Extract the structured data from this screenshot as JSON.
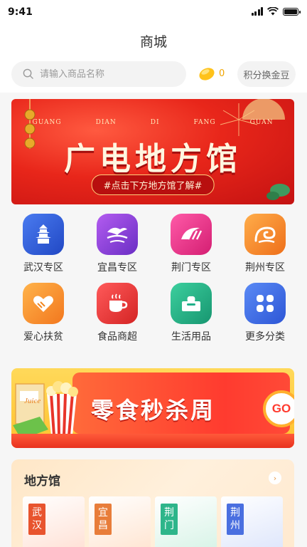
{
  "status_bar": {
    "time": "9:41"
  },
  "header": {
    "title": "商城"
  },
  "search": {
    "placeholder": "请输入商品名称",
    "coin_count": "0",
    "exchange_label": "积分换金豆"
  },
  "banner": {
    "pinyin": [
      "GUANG",
      "DIAN",
      "DI",
      "FANG",
      "GUAN"
    ],
    "title": "广电地方馆",
    "subtitle": "#点击下方地方馆了解#"
  },
  "categories": [
    {
      "label": "武汉专区",
      "icon": "wuhan-tower-icon",
      "color": "#2f5fd9"
    },
    {
      "label": "宜昌专区",
      "icon": "yichang-river-icon",
      "color": "#8a3fd9"
    },
    {
      "label": "荆门专区",
      "icon": "jingmen-emblem-icon",
      "color": "#e8348f"
    },
    {
      "label": "荆州专区",
      "icon": "jingzhou-wave-icon",
      "color": "#f28a2a"
    },
    {
      "label": "爱心扶贫",
      "icon": "heart-hands-icon",
      "color": "#f59a30"
    },
    {
      "label": "食品商超",
      "icon": "coffee-cup-icon",
      "color": "#e63b3b"
    },
    {
      "label": "生活用品",
      "icon": "tissue-box-icon",
      "color": "#21b08a"
    },
    {
      "label": "更多分类",
      "icon": "grid-more-icon",
      "color": "#3f6fe8"
    }
  ],
  "promo": {
    "title": "零食秒杀周",
    "go_label": "GO",
    "box_label": "Juice"
  },
  "local_hall": {
    "title": "地方馆",
    "tiles": [
      {
        "label": "武汉",
        "color": "#e8542e"
      },
      {
        "label": "宜昌",
        "color": "#e87d3a"
      },
      {
        "label": "荆门",
        "color": "#2eb58a"
      },
      {
        "label": "荆州",
        "color": "#4a6fe0"
      }
    ]
  }
}
